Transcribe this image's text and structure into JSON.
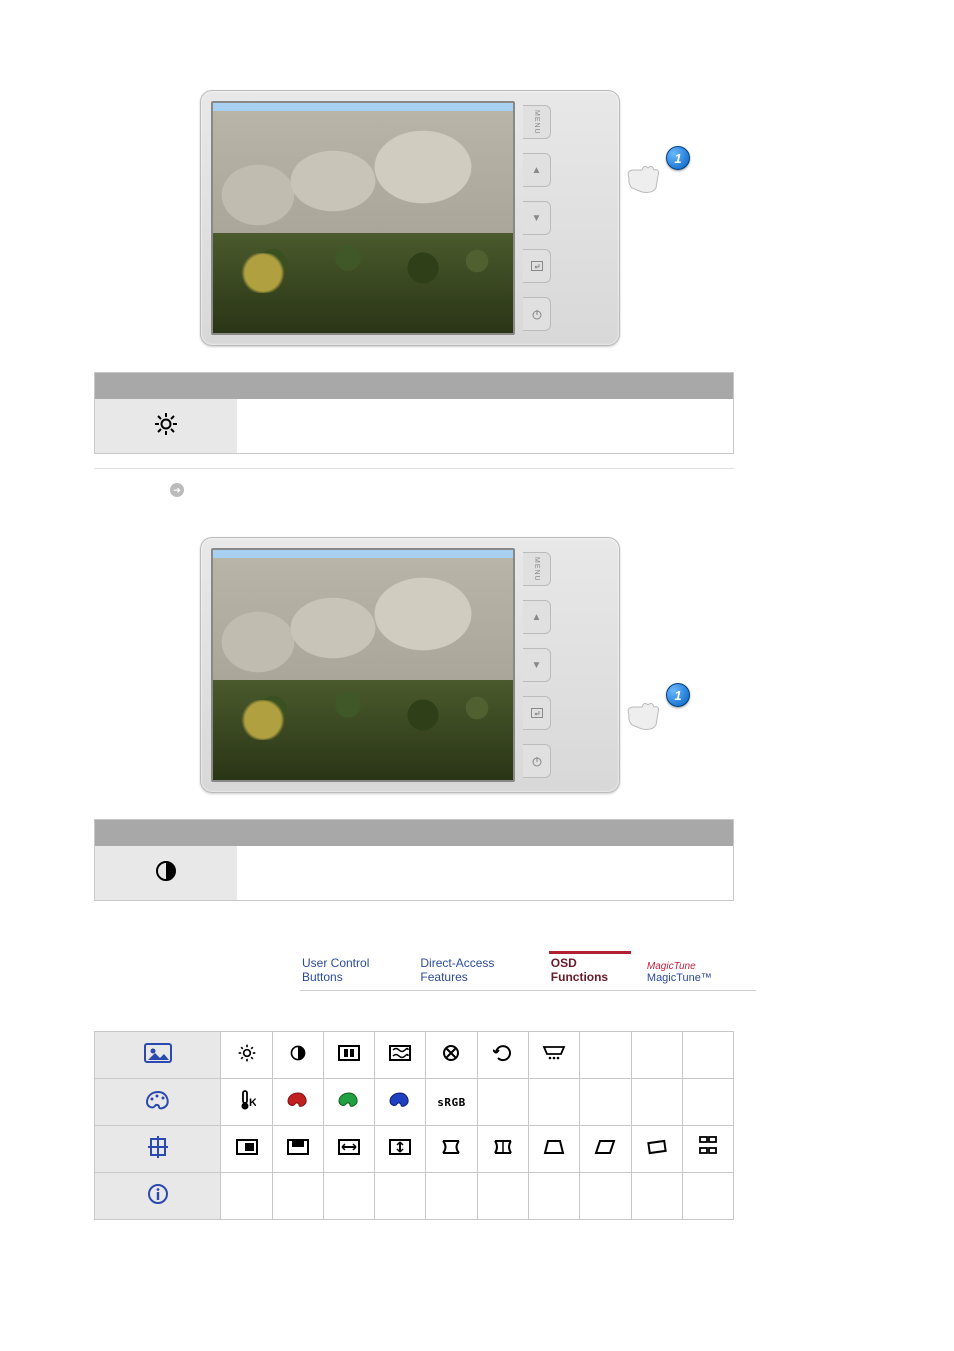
{
  "callout": {
    "badge_up": "1",
    "badge_down": "1"
  },
  "side_buttons": {
    "menu": "MENU",
    "up": "▲",
    "down": "▼",
    "enter": "↵",
    "power": "⏻"
  },
  "bullet": {
    "label": ""
  },
  "tabs": {
    "t1": "User Control Buttons",
    "t2": "Direct-Access Features",
    "t3": "OSD Functions",
    "t4_logo": "MagicTune",
    "t4": "MagicTune™"
  },
  "osd": {
    "srgb": "sRGB"
  }
}
